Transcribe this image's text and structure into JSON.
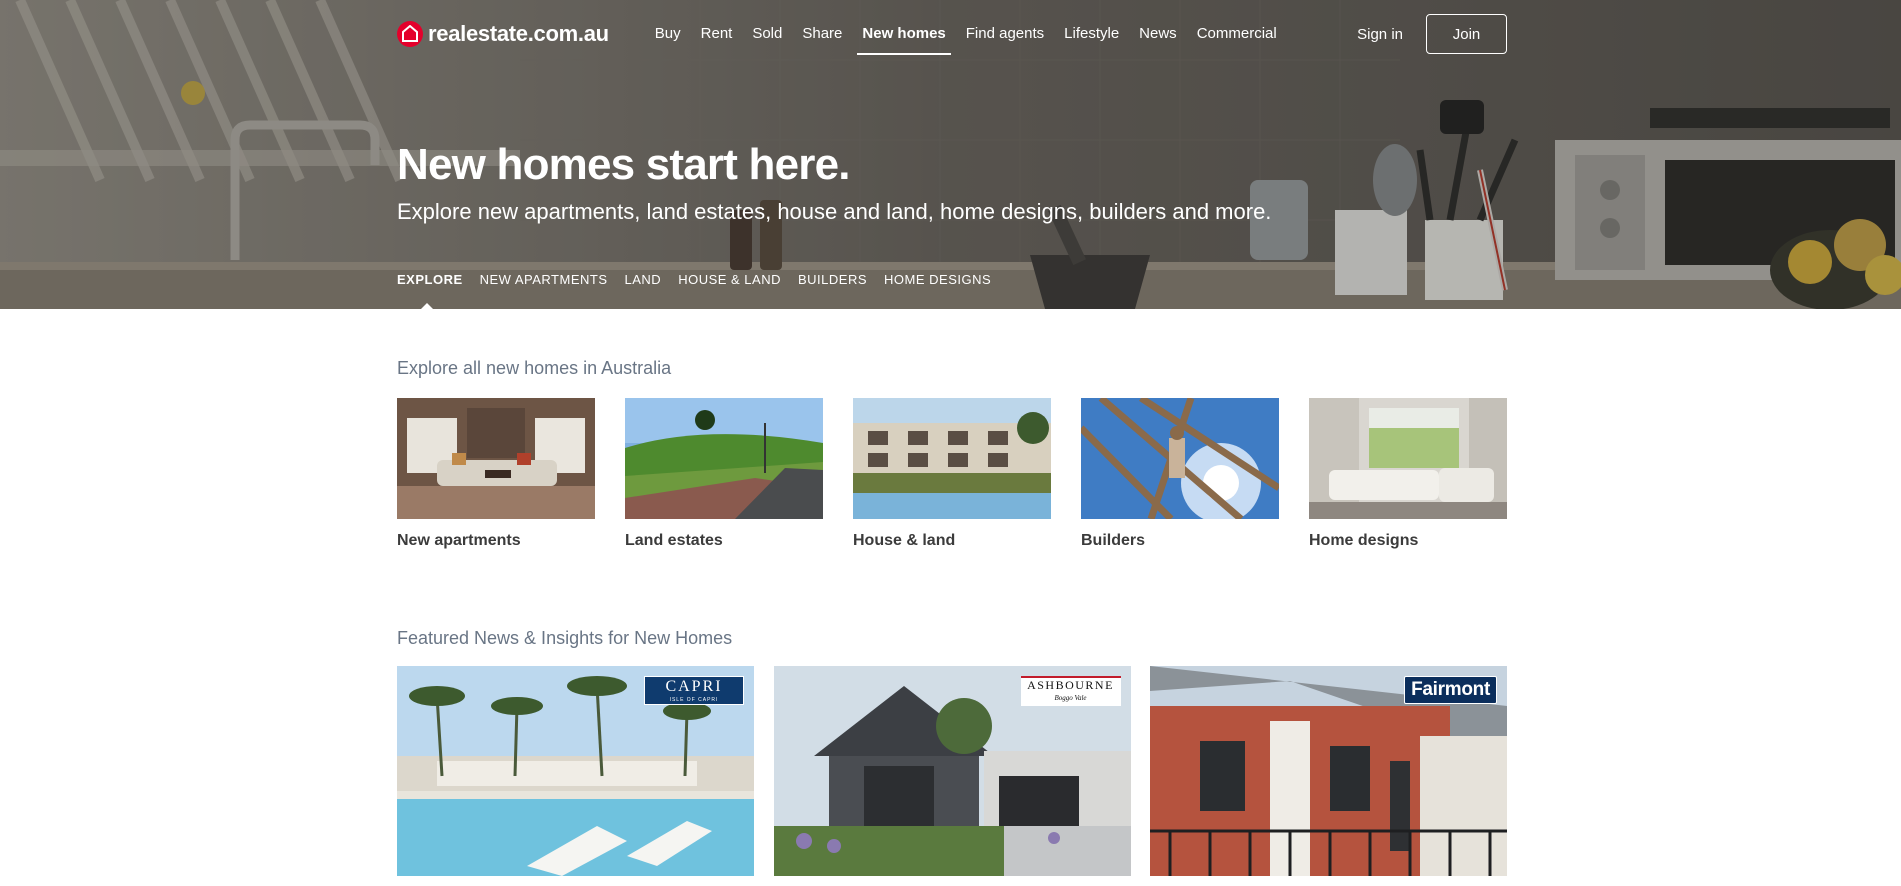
{
  "header": {
    "logo_text": "realestate.com.au",
    "nav": [
      "Buy",
      "Rent",
      "Sold",
      "Share",
      "New homes",
      "Find agents",
      "Lifestyle",
      "News",
      "Commercial"
    ],
    "active_nav": "New homes",
    "sign_in": "Sign in",
    "join": "Join"
  },
  "hero": {
    "headline": "New homes start here.",
    "subline": "Explore new apartments, land estates, house and land, home designs, builders and more.",
    "tabs": [
      "Explore",
      "New apartments",
      "Land",
      "House & land",
      "Builders",
      "Home designs"
    ],
    "active_tab": "Explore"
  },
  "explore": {
    "title": "Explore all new homes in Australia",
    "cards": [
      {
        "label": "New apartments"
      },
      {
        "label": "Land estates"
      },
      {
        "label": "House & land"
      },
      {
        "label": "Builders"
      },
      {
        "label": "Home designs"
      }
    ]
  },
  "news": {
    "title": "Featured News & Insights for New Homes",
    "cards": [
      {
        "brand": "CAPRI",
        "brand_sub": "ISLE OF CAPRI"
      },
      {
        "brand": "ASHBOURNE",
        "brand_sub": "Boggo Vale"
      },
      {
        "brand": "Fairmont"
      }
    ]
  },
  "colors": {
    "brand_red": "#e4002b",
    "section_title": "#697585",
    "card_label": "#3b3b3b"
  }
}
